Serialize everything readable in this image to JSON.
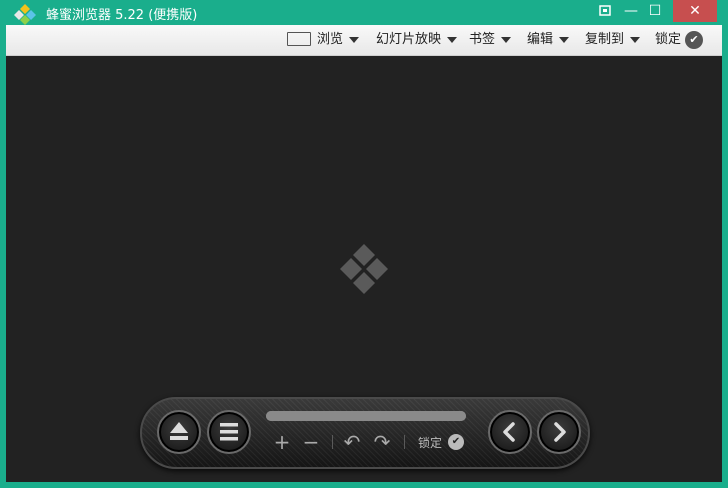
{
  "app": {
    "title": "蜂蜜浏览器 5.22 (便携版)",
    "accent_color": "#1aae8c"
  },
  "window_controls": {
    "fullscreen_icon": "fullscreen-icon",
    "minimize_glyph": "—",
    "maximize_glyph": "☐",
    "close_glyph": "✕"
  },
  "toolbar": {
    "browse_label": "浏览",
    "slideshow_label": "幻灯片放映",
    "bookmarks_label": "书签",
    "edit_label": "编辑",
    "copy_to_label": "复制到",
    "lock_label": "锁定",
    "lock_check_glyph": "✔"
  },
  "viewer": {
    "background": "#222222"
  },
  "controls": {
    "progress": 1.0,
    "zoom_in_glyph": "+",
    "zoom_out_glyph": "−",
    "rotate_left_glyph": "↶",
    "rotate_right_glyph": "↷",
    "lock_label": "锁定",
    "lock_check_glyph": "✔"
  }
}
